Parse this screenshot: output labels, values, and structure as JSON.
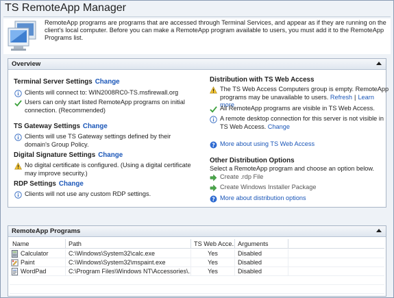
{
  "window": {
    "title": "TS RemoteApp Manager",
    "intro": "RemoteApp programs are programs that are accessed through Terminal Services, and appear as if they are running on the client's local computer. Before you can make a RemoteApp program available to users, you must add it to the RemoteApp Programs list."
  },
  "overview": {
    "header": "Overview",
    "terminal_server": {
      "title": "Terminal Server Settings",
      "change": "Change",
      "item1": "Clients will connect to: WIN2008RC0-TS.msfirewall.org",
      "item2": "Users can only start listed RemoteApp programs on initial connection. (Recommended)"
    },
    "ts_gateway": {
      "title": "TS Gateway Settings",
      "change": "Change",
      "item1": "Clients will use TS Gateway settings defined by their domain's Group Policy."
    },
    "digital_signature": {
      "title": "Digital Signature Settings",
      "change": "Change",
      "item1": "No digital certificate is configured. (Using a digital certificate may improve security.)"
    },
    "rdp": {
      "title": "RDP Settings",
      "change": "Change",
      "item1": "Clients will not use any custom RDP settings."
    },
    "distribution": {
      "title": "Distribution with TS Web Access",
      "warn_text": "The TS Web Access Computers group is empty. RemoteApp programs may be unavailable to users.",
      "refresh": "Refresh",
      "separator": "|",
      "learn_more": "Learn more",
      "visible": "All RemoteApp programs are visible in TS Web Access.",
      "rdc_text": "A remote desktop connection for this server is not visible in TS Web Access.",
      "rdc_change": "Change",
      "more_web": "More about using TS Web Access"
    },
    "other": {
      "title": "Other Distribution Options",
      "desc": "Select a RemoteApp program and choose an option below.",
      "create_rdp": "Create .rdp File",
      "create_msi": "Create Windows Installer Package",
      "more_dist": "More about distribution options"
    }
  },
  "programs": {
    "header": "RemoteApp Programs",
    "columns": [
      "Name",
      "Path",
      "TS Web Acce...",
      "Arguments"
    ],
    "rows": [
      {
        "name": "Calculator",
        "path": "C:\\Windows\\System32\\calc.exe",
        "web": "Yes",
        "args": "Disabled"
      },
      {
        "name": "Paint",
        "path": "C:\\Windows\\System32\\mspaint.exe",
        "web": "Yes",
        "args": "Disabled"
      },
      {
        "name": "WordPad",
        "path": "C:\\Program Files\\Windows NT\\Accessories\\...",
        "web": "Yes",
        "args": "Disabled"
      }
    ]
  }
}
